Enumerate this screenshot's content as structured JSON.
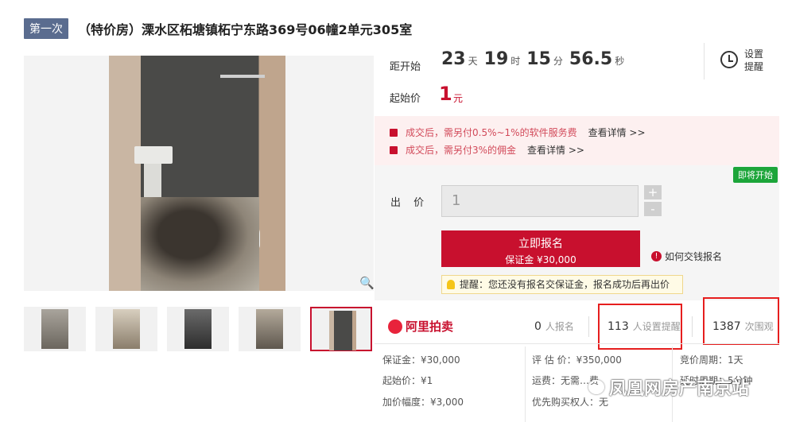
{
  "header": {
    "badge": "第一次",
    "title": "（特价房）溧水区柘塘镇柘宁东路369号06幢2单元305室"
  },
  "countdown": {
    "label": "距开始",
    "days": "23",
    "days_unit": "天",
    "hours": "19",
    "hours_unit": "时",
    "minutes": "15",
    "minutes_unit": "分",
    "seconds": "56.5",
    "seconds_unit": "秒"
  },
  "reminder": {
    "line1": "设置",
    "line2": "提醒",
    "icon": "alarm-clock-icon"
  },
  "start_price": {
    "label": "起始价",
    "value": "1",
    "unit": "元"
  },
  "fees": [
    {
      "text": "成交后，需另付0.5%~1%的软件服务费",
      "link": "查看详情 >>"
    },
    {
      "text": "成交后，需另付3%的佣金",
      "link": "查看详情 >>"
    }
  ],
  "bid": {
    "status": "即将开始",
    "label": "出 价",
    "value": "1",
    "plus": "+",
    "minus": "-",
    "apply_label": "立即报名",
    "deposit_label": "保证金 ¥30,000",
    "how_pay": "如何交钱报名",
    "tip": "提醒：您还没有报名交保证金，报名成功后再出价"
  },
  "stats": {
    "brand": "阿里拍卖",
    "signups": "0",
    "signups_label": "人报名",
    "reminders": "113",
    "reminders_label": "人设置提醒",
    "views": "1387",
    "views_label": "次围观"
  },
  "info": {
    "deposit": "保证金：¥30,000",
    "start": "起始价：¥1",
    "increment": "加价幅度：¥3,000",
    "appraisal": "评 估 价：¥350,000",
    "shipping": "运费：无需…费",
    "priority": "优先购买权人：无",
    "cycle": "竞价周期：1天",
    "delay": "延时周期：5分钟"
  },
  "watermark": "凤凰网房产南京站",
  "colors": {
    "accent": "#c8102e",
    "badge": "#5a6c8f",
    "green": "#1ca53a"
  }
}
